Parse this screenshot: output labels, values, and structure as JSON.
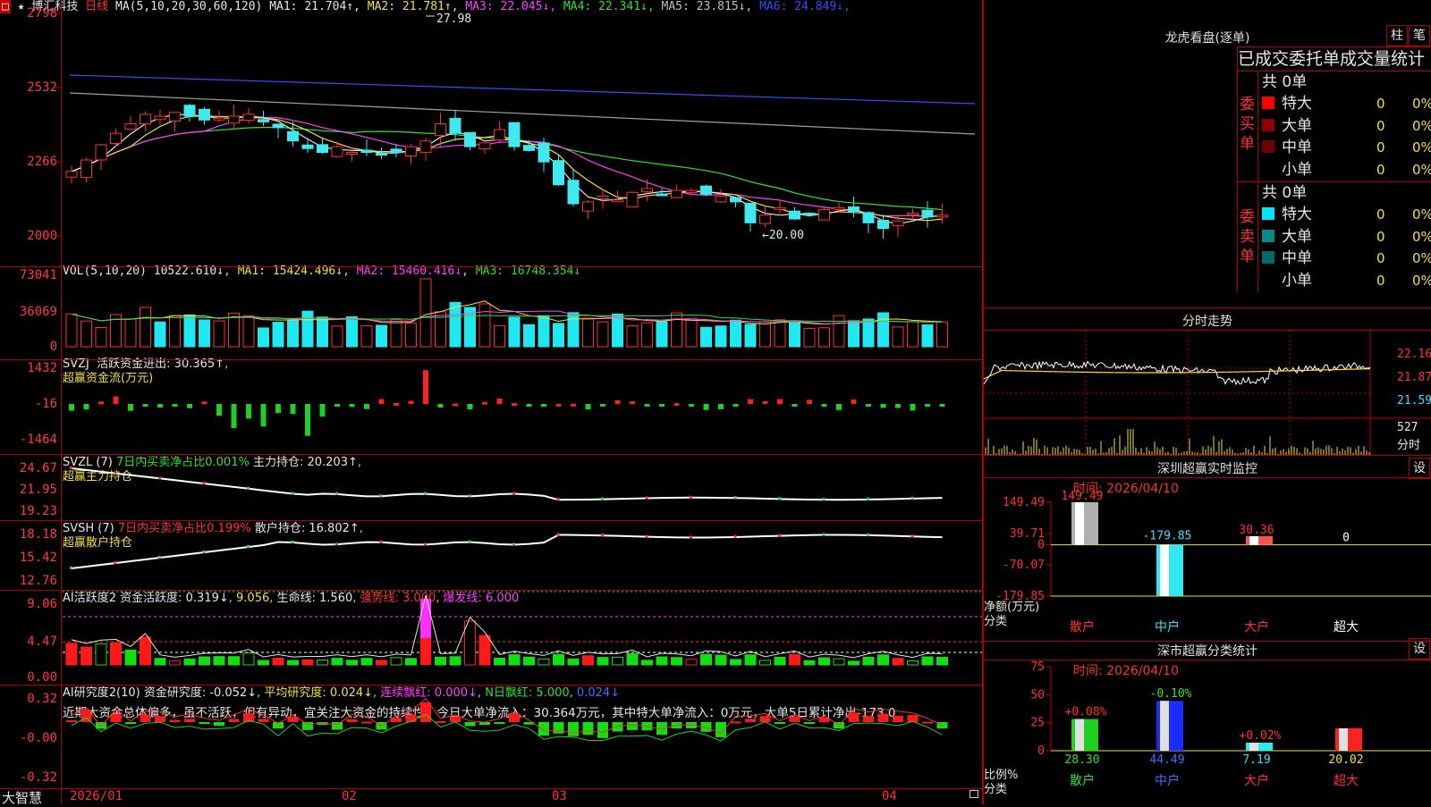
{
  "chart": {
    "title_prefix": "★",
    "stock_name": "博汇科技",
    "period": "日线",
    "ma_label": "MA(5,10,20,30,60,120)",
    "ma_values": [
      {
        "name": "MA1:",
        "value": "21.704↑",
        "color": "#e6e6e6"
      },
      {
        "name": "MA2:",
        "value": "21.781↑",
        "color": "#f0e040"
      },
      {
        "name": "MA3:",
        "value": "22.045↓",
        "color": "#ff40ff"
      },
      {
        "name": "MA4:",
        "value": "22.341↓",
        "color": "#30e030"
      },
      {
        "name": "MA5:",
        "value": "23.815↓",
        "color": "#c0c0c0"
      },
      {
        "name": "MA6:",
        "value": "24.849↓",
        "color": "#3050ff"
      }
    ],
    "price_axis": [
      "2798",
      "2532",
      "2266",
      "2000"
    ],
    "high_mark": "27.98",
    "low_mark": "←20.00",
    "volume": {
      "label": "VOL(5,10,20)",
      "value": "10522.610↓",
      "ma1": "MA1: 15424.496↓",
      "ma2": "MA2: 15460.416↓",
      "ma3": "MA3: 16748.354↓",
      "axis": [
        "73041",
        "36069",
        "0"
      ]
    },
    "svzj": {
      "label": "SVZJ",
      "text": "活跃资金进出: 30.365↑",
      "subtitle": "超赢资金流(万元)",
      "axis": [
        "1432",
        "-16",
        "-1464"
      ]
    },
    "svzl": {
      "label": "SVZL (7)",
      "text1": "7日内买卖净占比0.001%",
      "text2": "主力持仓: 20.203↑",
      "subtitle": "超赢主力持仓",
      "axis": [
        "24.67",
        "21.95",
        "19.23"
      ]
    },
    "svsh": {
      "label": "SVSH (7)",
      "text1": "7日内买卖净占比0.199%",
      "text2": "散户持仓: 16.802↑",
      "subtitle": "超赢散户持仓",
      "axis": [
        "18.18",
        "15.42",
        "12.76"
      ]
    },
    "ai1": {
      "label": "AI活跃度2",
      "t1": "资金活跃度: 0.319↓",
      "t2": "9.056",
      "t3": "生命线: 1.560",
      "t4": "强势线: 3.000",
      "t5": "爆发线: 6.000",
      "axis": [
        "9.06",
        "4.47",
        "0.00"
      ]
    },
    "ai2": {
      "label": "AI研究度2(10)",
      "t1": "资金研究度: -0.052↓",
      "t2": "平均研究度: 0.024↓",
      "t3": "连续飘红: 0.000↓",
      "t4": "N日飘红: 5.000",
      "t5": "0.024↓",
      "comment": "近期大资金总体偏多，虽不活跃，但有异动，宜关注大资金的持续性，今日大单净流入：30.364万元，其中特大单净流入：0万元，大单5日累计净出-173.0",
      "axis": [
        "0.32",
        "-0.00",
        "-0.32"
      ]
    },
    "date_axis": [
      "2026/01",
      "02",
      "03",
      "04"
    ],
    "brand": "大智慧"
  },
  "dragon_tiger": {
    "title": "龙虎看盘(逐单)",
    "btn1": "柱",
    "btn2": "笔",
    "heading": "已成交委托单成交量统计",
    "buy": {
      "side_label": "委买单",
      "total": "共 0单",
      "rows": [
        {
          "name": "特大",
          "count": "0",
          "pct": "0%",
          "color": "#ff0000"
        },
        {
          "name": "大单",
          "count": "0",
          "pct": "0%",
          "color": "#900000"
        },
        {
          "name": "中单",
          "count": "0",
          "pct": "0%",
          "color": "#700000"
        },
        {
          "name": "小单",
          "count": "0",
          "pct": "0%",
          "color": "#000000"
        }
      ]
    },
    "sell": {
      "side_label": "委卖单",
      "total": "共 0单",
      "rows": [
        {
          "name": "特大",
          "count": "0",
          "pct": "0%",
          "color": "#00e5ff"
        },
        {
          "name": "大单",
          "count": "0",
          "pct": "0%",
          "color": "#008a8a"
        },
        {
          "name": "中单",
          "count": "0",
          "pct": "0%",
          "color": "#006a6a"
        },
        {
          "name": "小单",
          "count": "0",
          "pct": "0%",
          "color": "#000000"
        }
      ]
    }
  },
  "intraday": {
    "title": "分时走势",
    "axis": [
      "22.16",
      "21.87",
      "21.59",
      "527",
      "分时"
    ]
  },
  "sz_monitor": {
    "title": "深圳超赢实时监控",
    "btn": "设",
    "time": "时间: 2026/04/10",
    "axis": [
      "149.49",
      "39.71",
      "0",
      "-70.07",
      "-179.85"
    ],
    "ylabel": "净额(万元)",
    "xlabel": "分类",
    "categories": [
      "散户",
      "中户",
      "大户",
      "超大"
    ],
    "values": [
      149.49,
      -179.85,
      30.36,
      0
    ],
    "value_labels": [
      "149.49",
      "-179.85",
      "30.36",
      "0"
    ]
  },
  "sz_class": {
    "title": "深市超赢分类统计",
    "btn": "设",
    "time": "时间: 2026/04/10",
    "axis": [
      "75",
      "50",
      "25",
      "0"
    ],
    "ylabel": "比例%",
    "xlabel": "分类",
    "categories": [
      "散户",
      "中户",
      "大户",
      "超大"
    ],
    "values": [
      28.3,
      44.49,
      7.19,
      20.02
    ],
    "value_labels": [
      "28.30",
      "44.49",
      "7.19",
      "20.02"
    ],
    "changes": [
      "+0.08%",
      "-0.10%",
      "+0.02%",
      ""
    ]
  },
  "chart_data": [
    {
      "type": "bar",
      "title": "深圳超赢实时监控",
      "ylabel": "净额(万元)",
      "xlabel": "分类",
      "categories": [
        "散户",
        "中户",
        "大户",
        "超大"
      ],
      "values": [
        149.49,
        -179.85,
        30.36,
        0
      ],
      "ylim": [
        -179.85,
        149.49
      ]
    },
    {
      "type": "bar",
      "title": "深市超赢分类统计",
      "ylabel": "比例%",
      "xlabel": "分类",
      "categories": [
        "散户",
        "中户",
        "大户",
        "超大"
      ],
      "values": [
        28.3,
        44.49,
        7.19,
        20.02
      ],
      "ylim": [
        0,
        75
      ]
    }
  ]
}
